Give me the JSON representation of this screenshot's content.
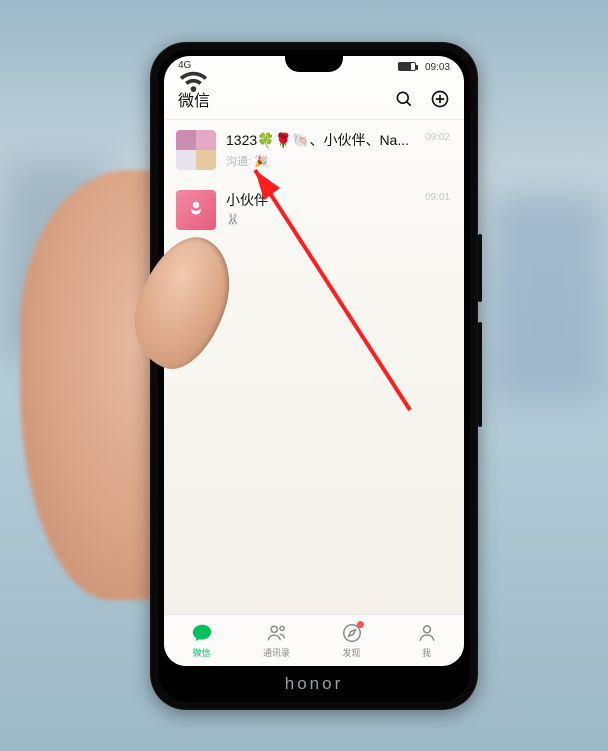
{
  "status_bar": {
    "signal_label": "4G",
    "time": "09:03"
  },
  "header": {
    "title": "微信"
  },
  "chats": [
    {
      "title_text": "1323🍀🌹🐚、小伙伴、Na...",
      "sender": "沟通:",
      "preview": "🎉",
      "time": "09:02"
    },
    {
      "title_text": "小伙伴",
      "preview": "🐰",
      "time": "09:01"
    }
  ],
  "tabs": [
    {
      "label": "微信"
    },
    {
      "label": "通讯录"
    },
    {
      "label": "发现"
    },
    {
      "label": "我"
    }
  ],
  "phone_brand": "honor"
}
